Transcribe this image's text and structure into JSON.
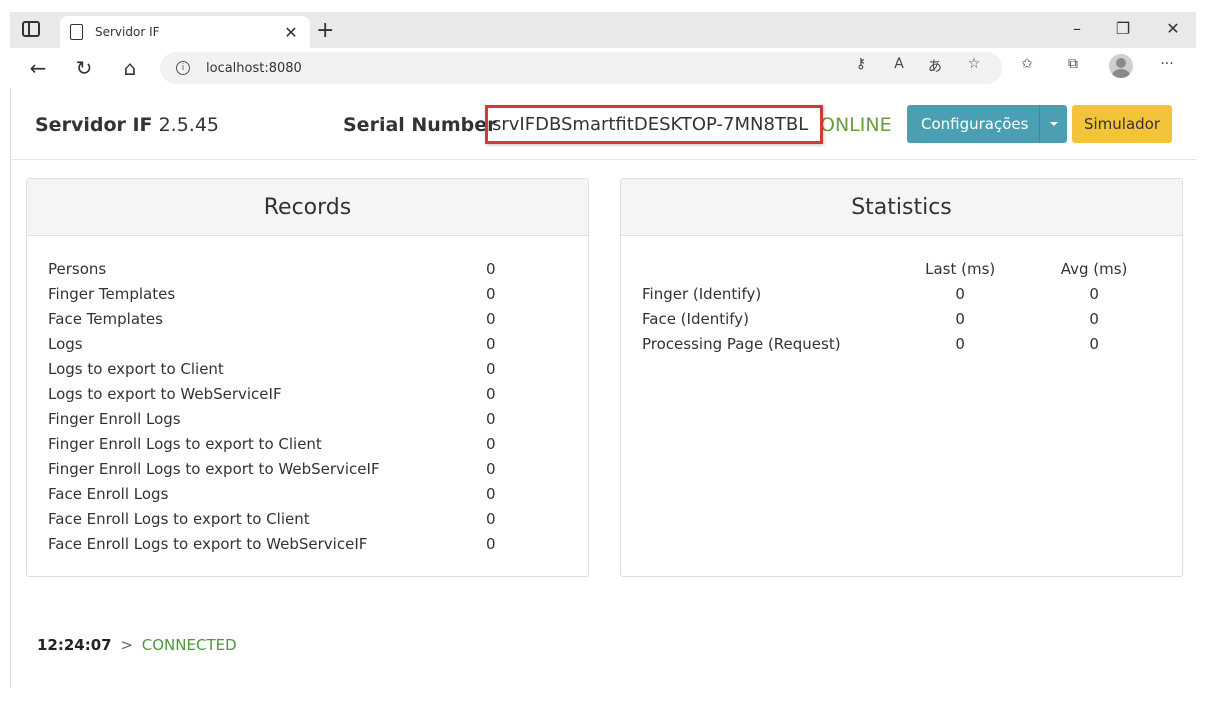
{
  "browser": {
    "tab_title": "Servidor IF",
    "url": "localhost:8080"
  },
  "header": {
    "app_name": "Servidor IF",
    "version": "2.5.45",
    "serial_label": "Serial Number",
    "serial_value": "srvIFDBSmartfitDESKTOP-7MN8TBL",
    "status": "ONLINE",
    "config_button": "Configurações",
    "simulator_button": "Simulador"
  },
  "records": {
    "title": "Records",
    "rows": [
      {
        "label": "Persons",
        "value": "0"
      },
      {
        "label": "Finger Templates",
        "value": "0"
      },
      {
        "label": "Face Templates",
        "value": "0"
      },
      {
        "label": "Logs",
        "value": "0"
      },
      {
        "label": "Logs to export to Client",
        "value": "0"
      },
      {
        "label": "Logs to export to WebServiceIF",
        "value": "0"
      },
      {
        "label": "Finger Enroll Logs",
        "value": "0"
      },
      {
        "label": "Finger Enroll Logs to export to Client",
        "value": "0"
      },
      {
        "label": "Finger Enroll Logs to export to WebServiceIF",
        "value": "0"
      },
      {
        "label": "Face Enroll Logs",
        "value": "0"
      },
      {
        "label": "Face Enroll Logs to export to Client",
        "value": "0"
      },
      {
        "label": "Face Enroll Logs to export to WebServiceIF",
        "value": "0"
      }
    ]
  },
  "statistics": {
    "title": "Statistics",
    "columns": [
      "Last (ms)",
      "Avg (ms)"
    ],
    "rows": [
      {
        "label": "Finger (Identify)",
        "last": "0",
        "avg": "0"
      },
      {
        "label": "Face (Identify)",
        "last": "0",
        "avg": "0"
      },
      {
        "label": "Processing Page (Request)",
        "last": "0",
        "avg": "0"
      }
    ]
  },
  "footer": {
    "time": "12:24:07",
    "separator": ">",
    "state": "CONNECTED"
  },
  "colors": {
    "online": "#6a9e3d",
    "config_button": "#4a9fb2",
    "simulator_button": "#f3c33a",
    "highlight_box": "#d23a3a",
    "connected": "#4a9a3a"
  }
}
